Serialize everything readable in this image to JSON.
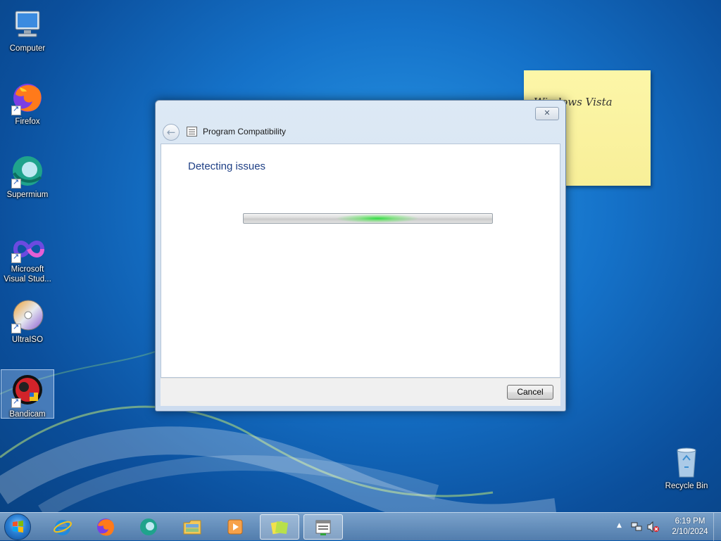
{
  "desktop": {
    "icons": [
      {
        "label": "Computer",
        "icon": "computer-icon"
      },
      {
        "label": "Firefox",
        "icon": "firefox-icon"
      },
      {
        "label": "Supermium",
        "icon": "supermium-icon"
      },
      {
        "label": "Microsoft Visual Stud...",
        "icon": "visual-studio-icon"
      },
      {
        "label": "UltraISO",
        "icon": "ultraiso-icon"
      },
      {
        "label": "Bandicam",
        "icon": "bandicam-icon"
      },
      {
        "label": "Recycle Bin",
        "icon": "recycle-bin-icon"
      }
    ],
    "sticky_note": {
      "text": "Windows Vista",
      "color": "#fcf6a8"
    }
  },
  "dialog": {
    "title": "Program Compatibility",
    "heading": "Detecting issues",
    "close_label": "✕",
    "cancel_label": "Cancel",
    "progress": "indeterminate"
  },
  "taskbar": {
    "pinned": [
      "internet-explorer-icon",
      "firefox-icon",
      "supermium-icon",
      "file-explorer-icon",
      "media-player-icon",
      "sticky-notes-icon",
      "program-compatibility-icon"
    ],
    "clock": {
      "time": "6:19 PM",
      "date": "2/10/2024"
    }
  },
  "colors": {
    "accent": "#1e3f85",
    "progress_glow": "#28dc3c",
    "desktop": "#1572c9"
  }
}
